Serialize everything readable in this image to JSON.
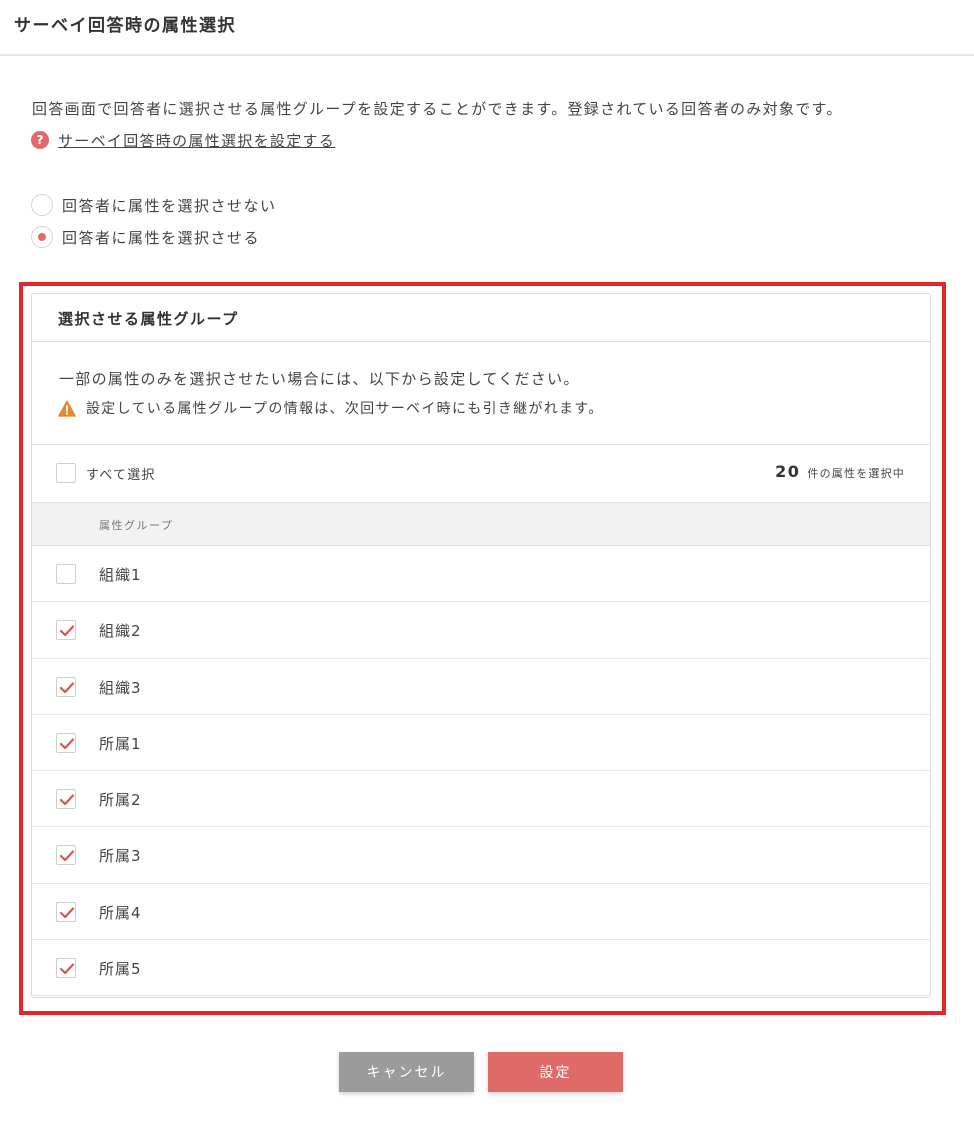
{
  "page": {
    "title": "サーベイ回答時の属性選択"
  },
  "intro": {
    "text": "回答画面で回答者に選択させる属性グループを設定することができます。登録されている回答者のみ対象です。",
    "help_icon": "?",
    "help_link": "サーベイ回答時の属性選択を設定する"
  },
  "radios": [
    {
      "label": "回答者に属性を選択させない",
      "checked": false
    },
    {
      "label": "回答者に属性を選択させる",
      "checked": true
    }
  ],
  "panel": {
    "title": "選択させる属性グループ",
    "info": "一部の属性のみを選択させたい場合には、以下から設定してください。",
    "warning": "設定している属性グループの情報は、次回サーベイ時にも引き継がれます。",
    "select_all_label": "すべて選択",
    "select_all_checked": false,
    "selected_count": "20",
    "selected_count_suffix": "件の属性を選択中",
    "column_header": "属性グループ",
    "rows": [
      {
        "label": "組織1",
        "checked": false
      },
      {
        "label": "組織2",
        "checked": true
      },
      {
        "label": "組織3",
        "checked": true
      },
      {
        "label": "所属1",
        "checked": true
      },
      {
        "label": "所属2",
        "checked": true
      },
      {
        "label": "所属3",
        "checked": true
      },
      {
        "label": "所属4",
        "checked": true
      },
      {
        "label": "所属5",
        "checked": true
      }
    ]
  },
  "buttons": {
    "cancel": "キャンセル",
    "save": "設定"
  },
  "colors": {
    "accent": "#e06a6a",
    "highlight_frame": "#e3262b",
    "warning": "#e8872b",
    "cancel_button": "#9b9b9b"
  },
  "icons": {
    "help": "question-circle-icon",
    "warning": "warning-triangle-icon",
    "check": "check-icon"
  }
}
